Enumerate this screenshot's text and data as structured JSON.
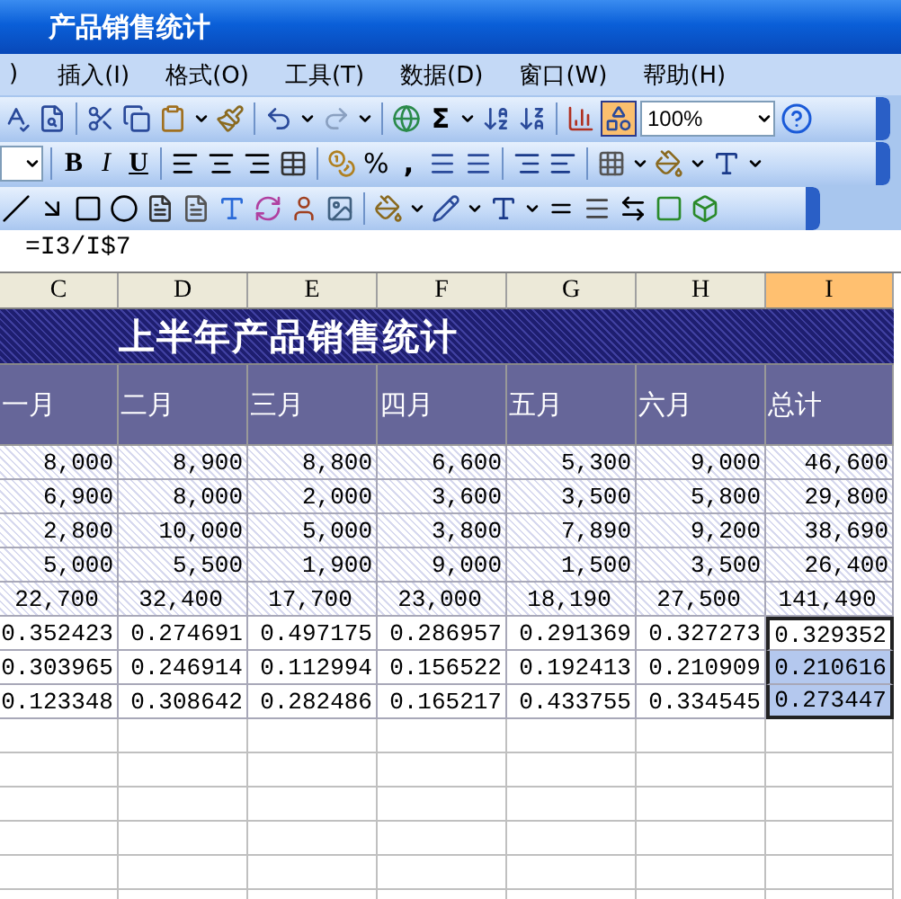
{
  "window": {
    "title": "产品销售统计"
  },
  "menu": [
    ")",
    "插入(I)",
    "格式(O)",
    "工具(T)",
    "数据(D)",
    "窗口(W)",
    "帮助(H)"
  ],
  "standard_toolbar": {
    "sum": "Σ",
    "zoom": "100%",
    "drawing_toggle_on": true
  },
  "formatting_toolbar": {
    "bold": "B",
    "italic": "I",
    "underline": "U",
    "percent": "%",
    "comma": ","
  },
  "formula_bar": {
    "value": "=I3/I$7"
  },
  "columns": [
    {
      "label": "C",
      "selected": false
    },
    {
      "label": "D",
      "selected": false
    },
    {
      "label": "E",
      "selected": false
    },
    {
      "label": "F",
      "selected": false
    },
    {
      "label": "G",
      "selected": false
    },
    {
      "label": "H",
      "selected": false
    },
    {
      "label": "I",
      "selected": true
    }
  ],
  "sheet_title": "上半年产品销售统计",
  "header_row": [
    "一月",
    "二月",
    "三月",
    "四月",
    "五月",
    "六月",
    "总计"
  ],
  "rows": [
    {
      "kind": "data",
      "cells": [
        {
          "text": "8,000",
          "selected": false
        },
        {
          "text": "8,900",
          "selected": false
        },
        {
          "text": "8,800",
          "selected": false
        },
        {
          "text": "6,600",
          "selected": false
        },
        {
          "text": "5,300",
          "selected": false
        },
        {
          "text": "9,000",
          "selected": false
        },
        {
          "text": "46,600",
          "selected": false
        }
      ]
    },
    {
      "kind": "data",
      "cells": [
        {
          "text": "6,900",
          "selected": false
        },
        {
          "text": "8,000",
          "selected": false
        },
        {
          "text": "2,000",
          "selected": false
        },
        {
          "text": "3,600",
          "selected": false
        },
        {
          "text": "3,500",
          "selected": false
        },
        {
          "text": "5,800",
          "selected": false
        },
        {
          "text": "29,800",
          "selected": false
        }
      ]
    },
    {
      "kind": "data",
      "cells": [
        {
          "text": "2,800",
          "selected": false
        },
        {
          "text": "10,000",
          "selected": false
        },
        {
          "text": "5,000",
          "selected": false
        },
        {
          "text": "3,800",
          "selected": false
        },
        {
          "text": "7,890",
          "selected": false
        },
        {
          "text": "9,200",
          "selected": false
        },
        {
          "text": "38,690",
          "selected": false
        }
      ]
    },
    {
      "kind": "data",
      "cells": [
        {
          "text": "5,000",
          "selected": false
        },
        {
          "text": "5,500",
          "selected": false
        },
        {
          "text": "1,900",
          "selected": false
        },
        {
          "text": "9,000",
          "selected": false
        },
        {
          "text": "1,500",
          "selected": false
        },
        {
          "text": "3,500",
          "selected": false
        },
        {
          "text": "26,400",
          "selected": false
        }
      ]
    },
    {
      "kind": "total",
      "cells": [
        {
          "text": "22,700",
          "selected": false
        },
        {
          "text": "32,400",
          "selected": false
        },
        {
          "text": "17,700",
          "selected": false
        },
        {
          "text": "23,000",
          "selected": false
        },
        {
          "text": "18,190",
          "selected": false
        },
        {
          "text": "27,500",
          "selected": false
        },
        {
          "text": "141,490",
          "selected": false
        }
      ]
    },
    {
      "kind": "ratio",
      "cells": [
        {
          "text": "0.352423",
          "selected": false
        },
        {
          "text": "0.274691",
          "selected": false
        },
        {
          "text": "0.497175",
          "selected": false
        },
        {
          "text": "0.286957",
          "selected": false
        },
        {
          "text": "0.291369",
          "selected": false
        },
        {
          "text": "0.327273",
          "selected": false
        },
        {
          "text": "0.329352",
          "selected": true
        }
      ]
    },
    {
      "kind": "ratio",
      "cells": [
        {
          "text": "0.303965",
          "selected": false
        },
        {
          "text": "0.246914",
          "selected": false
        },
        {
          "text": "0.112994",
          "selected": false
        },
        {
          "text": "0.156522",
          "selected": false
        },
        {
          "text": "0.192413",
          "selected": false
        },
        {
          "text": "0.210909",
          "selected": false
        },
        {
          "text": "0.210616",
          "selected": true
        }
      ]
    },
    {
      "kind": "ratio",
      "cells": [
        {
          "text": "0.123348",
          "selected": false
        },
        {
          "text": "0.308642",
          "selected": false
        },
        {
          "text": "0.282486",
          "selected": false
        },
        {
          "text": "0.165217",
          "selected": false
        },
        {
          "text": "0.433755",
          "selected": false
        },
        {
          "text": "0.334545",
          "selected": false
        },
        {
          "text": "0.273447",
          "selected": true
        }
      ]
    }
  ]
}
